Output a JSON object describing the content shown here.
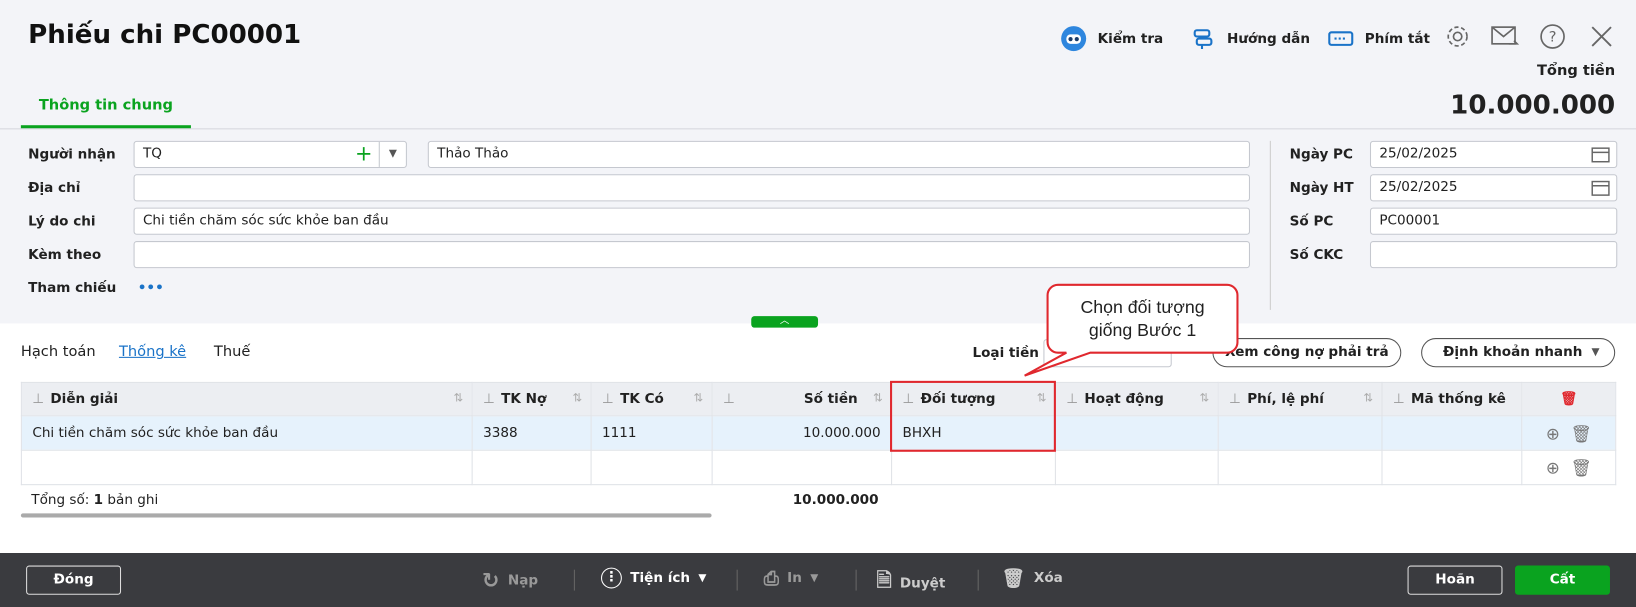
{
  "header": {
    "title": "Phiếu chi PC00001",
    "tools": [
      "Kiểm tra",
      "Hướng dẫn",
      "Phím tắt"
    ],
    "total_label": "Tổng tiền",
    "total_value": "10.000.000"
  },
  "tabs": {
    "main": "Thông tin chung"
  },
  "form": {
    "nguoi_nhan_label": "Người nhận",
    "nguoi_nhan_code": "TQ",
    "nguoi_nhan_name": "Thảo Thảo",
    "dia_chi_label": "Địa chỉ",
    "dia_chi": "",
    "ly_do_label": "Lý do chi",
    "ly_do": "Chi tiền chăm sóc sức khỏe ban đầu",
    "kem_theo_label": "Kèm theo",
    "kem_theo": "",
    "tham_chieu_label": "Tham chiếu",
    "tham_chieu_dots": "•••",
    "ngay_pc_label": "Ngày PC",
    "ngay_pc": "25/02/2025",
    "ngay_ht_label": "Ngày HT",
    "ngay_ht": "25/02/2025",
    "so_pc_label": "Số PC",
    "so_pc": "PC00001",
    "so_ckc_label": "Số CKC",
    "so_ckc": ""
  },
  "detail": {
    "tabs": [
      "Hạch toán",
      "Thống kê",
      "Thuế"
    ],
    "active_tab": "Thống kê",
    "loai_tien_label": "Loại tiền",
    "btn_cong_no": "Xem công nợ phải trả",
    "btn_dinh_khoan": "Định khoản nhanh"
  },
  "callout": {
    "line1": "Chọn đối tượng",
    "line2": "giống Bước 1"
  },
  "table": {
    "columns": [
      "Diễn giải",
      "TK Nợ",
      "TK Có",
      "Số tiền",
      "Đối tượng",
      "Hoạt động",
      "Phí, lệ phí",
      "Mã thống kê"
    ],
    "rows": [
      [
        "Chi tiền chăm sóc sức khỏe ban đầu",
        "3388",
        "1111",
        "10.000.000",
        "BHXH",
        "",
        "",
        ""
      ]
    ],
    "footer_prefix": "Tổng số: ",
    "footer_count": "1",
    "footer_suffix": " bản ghi",
    "footer_total": "10.000.000"
  },
  "footer": {
    "dong": "Đóng",
    "nap": "Nạp",
    "tien_ich": "Tiện ích",
    "in": "In",
    "duyet": "Duyệt",
    "xoa": "Xóa",
    "hoan": "Hoãn",
    "cat": "Cất"
  },
  "colors": {
    "accent": "#0aa31f",
    "link": "#1a73c8",
    "highlight": "#e0282e"
  }
}
